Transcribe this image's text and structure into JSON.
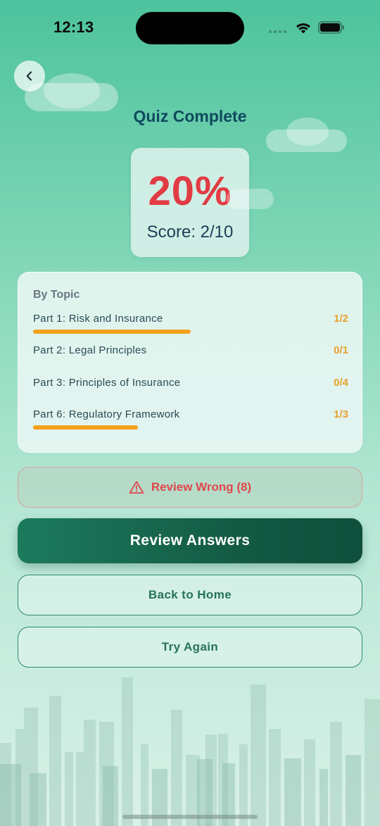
{
  "status_bar": {
    "time": "12:13"
  },
  "icons": {
    "back": "chevron-left-icon",
    "warning": "warning-triangle-icon"
  },
  "header": {
    "title": "Quiz Complete"
  },
  "score": {
    "percent": "20%",
    "label": "Score: 2/10"
  },
  "topics": {
    "heading": "By Topic",
    "items": [
      {
        "name": "Part 1: Risk and Insurance",
        "score": "1/2",
        "fraction": 0.5
      },
      {
        "name": "Part 2: Legal Principles",
        "score": "0/1",
        "fraction": 0
      },
      {
        "name": "Part 3: Principles of Insurance",
        "score": "0/4",
        "fraction": 0
      },
      {
        "name": "Part 6: Regulatory Framework",
        "score": "1/3",
        "fraction": 0.3333
      }
    ]
  },
  "actions": {
    "review_wrong": "Review Wrong (8)",
    "review_answers": "Review Answers",
    "back_home": "Back to Home",
    "try_again": "Try Again"
  },
  "colors": {
    "accent_orange": "#f3a11c",
    "error_red": "#e23b44",
    "primary_green": "#145c45",
    "title_navy": "#0f4a5e"
  }
}
